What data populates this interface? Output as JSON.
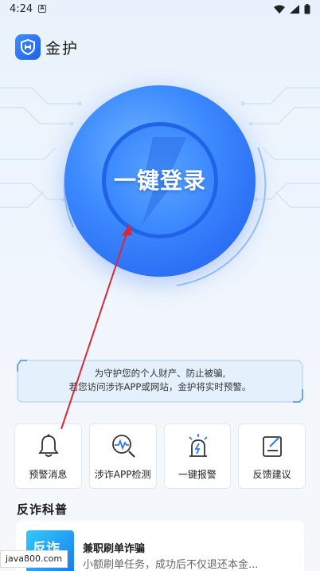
{
  "status_bar": {
    "time": "4:24",
    "notif_letter": "A"
  },
  "header": {
    "title": "金护"
  },
  "login": {
    "label": "一键登录"
  },
  "notice": {
    "line1": "为守护您的个人财产、防止被骗,",
    "line2": "若您访问涉诈APP或网站，金护将实时预警。"
  },
  "actions": [
    {
      "label": "预警消息",
      "icon": "bell-icon"
    },
    {
      "label": "涉诈APP检测",
      "icon": "app-scan-icon"
    },
    {
      "label": "一键报警",
      "icon": "alarm-icon"
    },
    {
      "label": "反馈建议",
      "icon": "feedback-icon"
    }
  ],
  "section": {
    "title": "反诈科普"
  },
  "article": {
    "thumb_text": "反诈",
    "title": "兼职刷单诈骗",
    "desc": "小额刷单任务，成功后不仅退还本金..."
  },
  "watermark": "java800.com",
  "colors": {
    "accent": "#2f78f2",
    "brand": "#1f62e6",
    "arrow": "#d9273a"
  }
}
